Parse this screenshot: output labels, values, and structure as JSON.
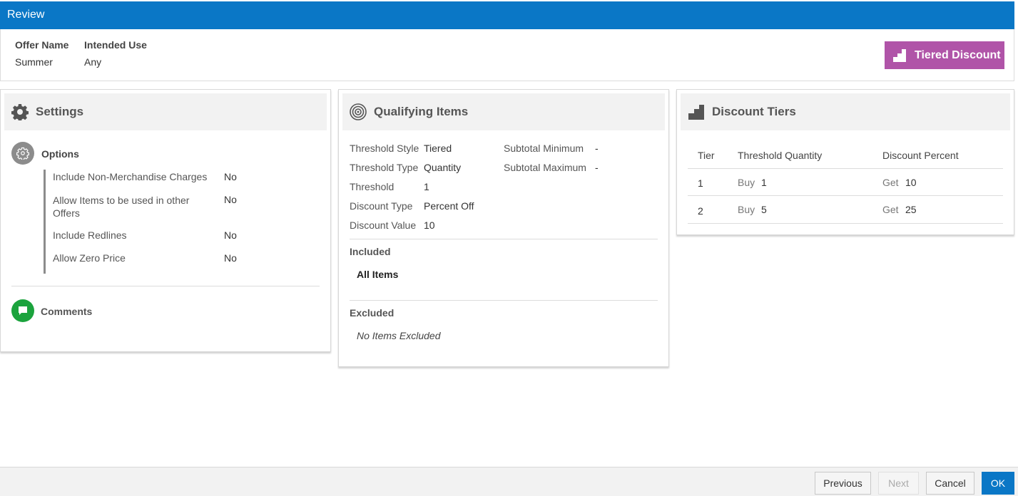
{
  "window": {
    "title": "Review"
  },
  "header": {
    "offer_name_label": "Offer Name",
    "offer_name_value": "Summer",
    "intended_use_label": "Intended Use",
    "intended_use_value": "Any",
    "badge_label": "Tiered Discount",
    "badge_color": "#b054a8",
    "badge_icon": "stairs-icon"
  },
  "settings": {
    "title": "Settings",
    "icon": "gear-icon",
    "options_title": "Options",
    "options": [
      {
        "label": "Include Non-Merchandise Charges",
        "value": "No"
      },
      {
        "label": "Allow Items to be used in other Offers",
        "value": "No"
      },
      {
        "label": "Include Redlines",
        "value": "No"
      },
      {
        "label": "Allow Zero Price",
        "value": "No"
      }
    ],
    "comments_title": "Comments",
    "comments_color": "#1ba33d"
  },
  "qualifying": {
    "title": "Qualifying Items",
    "icon": "target-icon",
    "fields": [
      {
        "label": "Threshold Style",
        "value": "Tiered"
      },
      {
        "label": "Threshold Type",
        "value": "Quantity"
      },
      {
        "label": "Threshold",
        "value": "1"
      },
      {
        "label": "Discount Type",
        "value": "Percent Off"
      },
      {
        "label": "Discount Value",
        "value": "10"
      }
    ],
    "right_fields": [
      {
        "label": "Subtotal Minimum",
        "value": "-"
      },
      {
        "label": "Subtotal Maximum",
        "value": "-"
      }
    ],
    "included_title": "Included",
    "included_value": "All Items",
    "excluded_title": "Excluded",
    "excluded_value": "No Items Excluded"
  },
  "tiers": {
    "title": "Discount Tiers",
    "icon": "stairs-icon",
    "columns": [
      "Tier",
      "Threshold Quantity",
      "Discount Percent"
    ],
    "rows": [
      {
        "tier": "1",
        "buy_label": "Buy",
        "buy": "1",
        "get_label": "Get",
        "get": "10"
      },
      {
        "tier": "2",
        "buy_label": "Buy",
        "buy": "5",
        "get_label": "Get",
        "get": "25"
      }
    ]
  },
  "footer": {
    "previous": "Previous",
    "next": "Next",
    "cancel": "Cancel",
    "ok": "OK"
  },
  "colors": {
    "primary": "#0a77c6"
  }
}
